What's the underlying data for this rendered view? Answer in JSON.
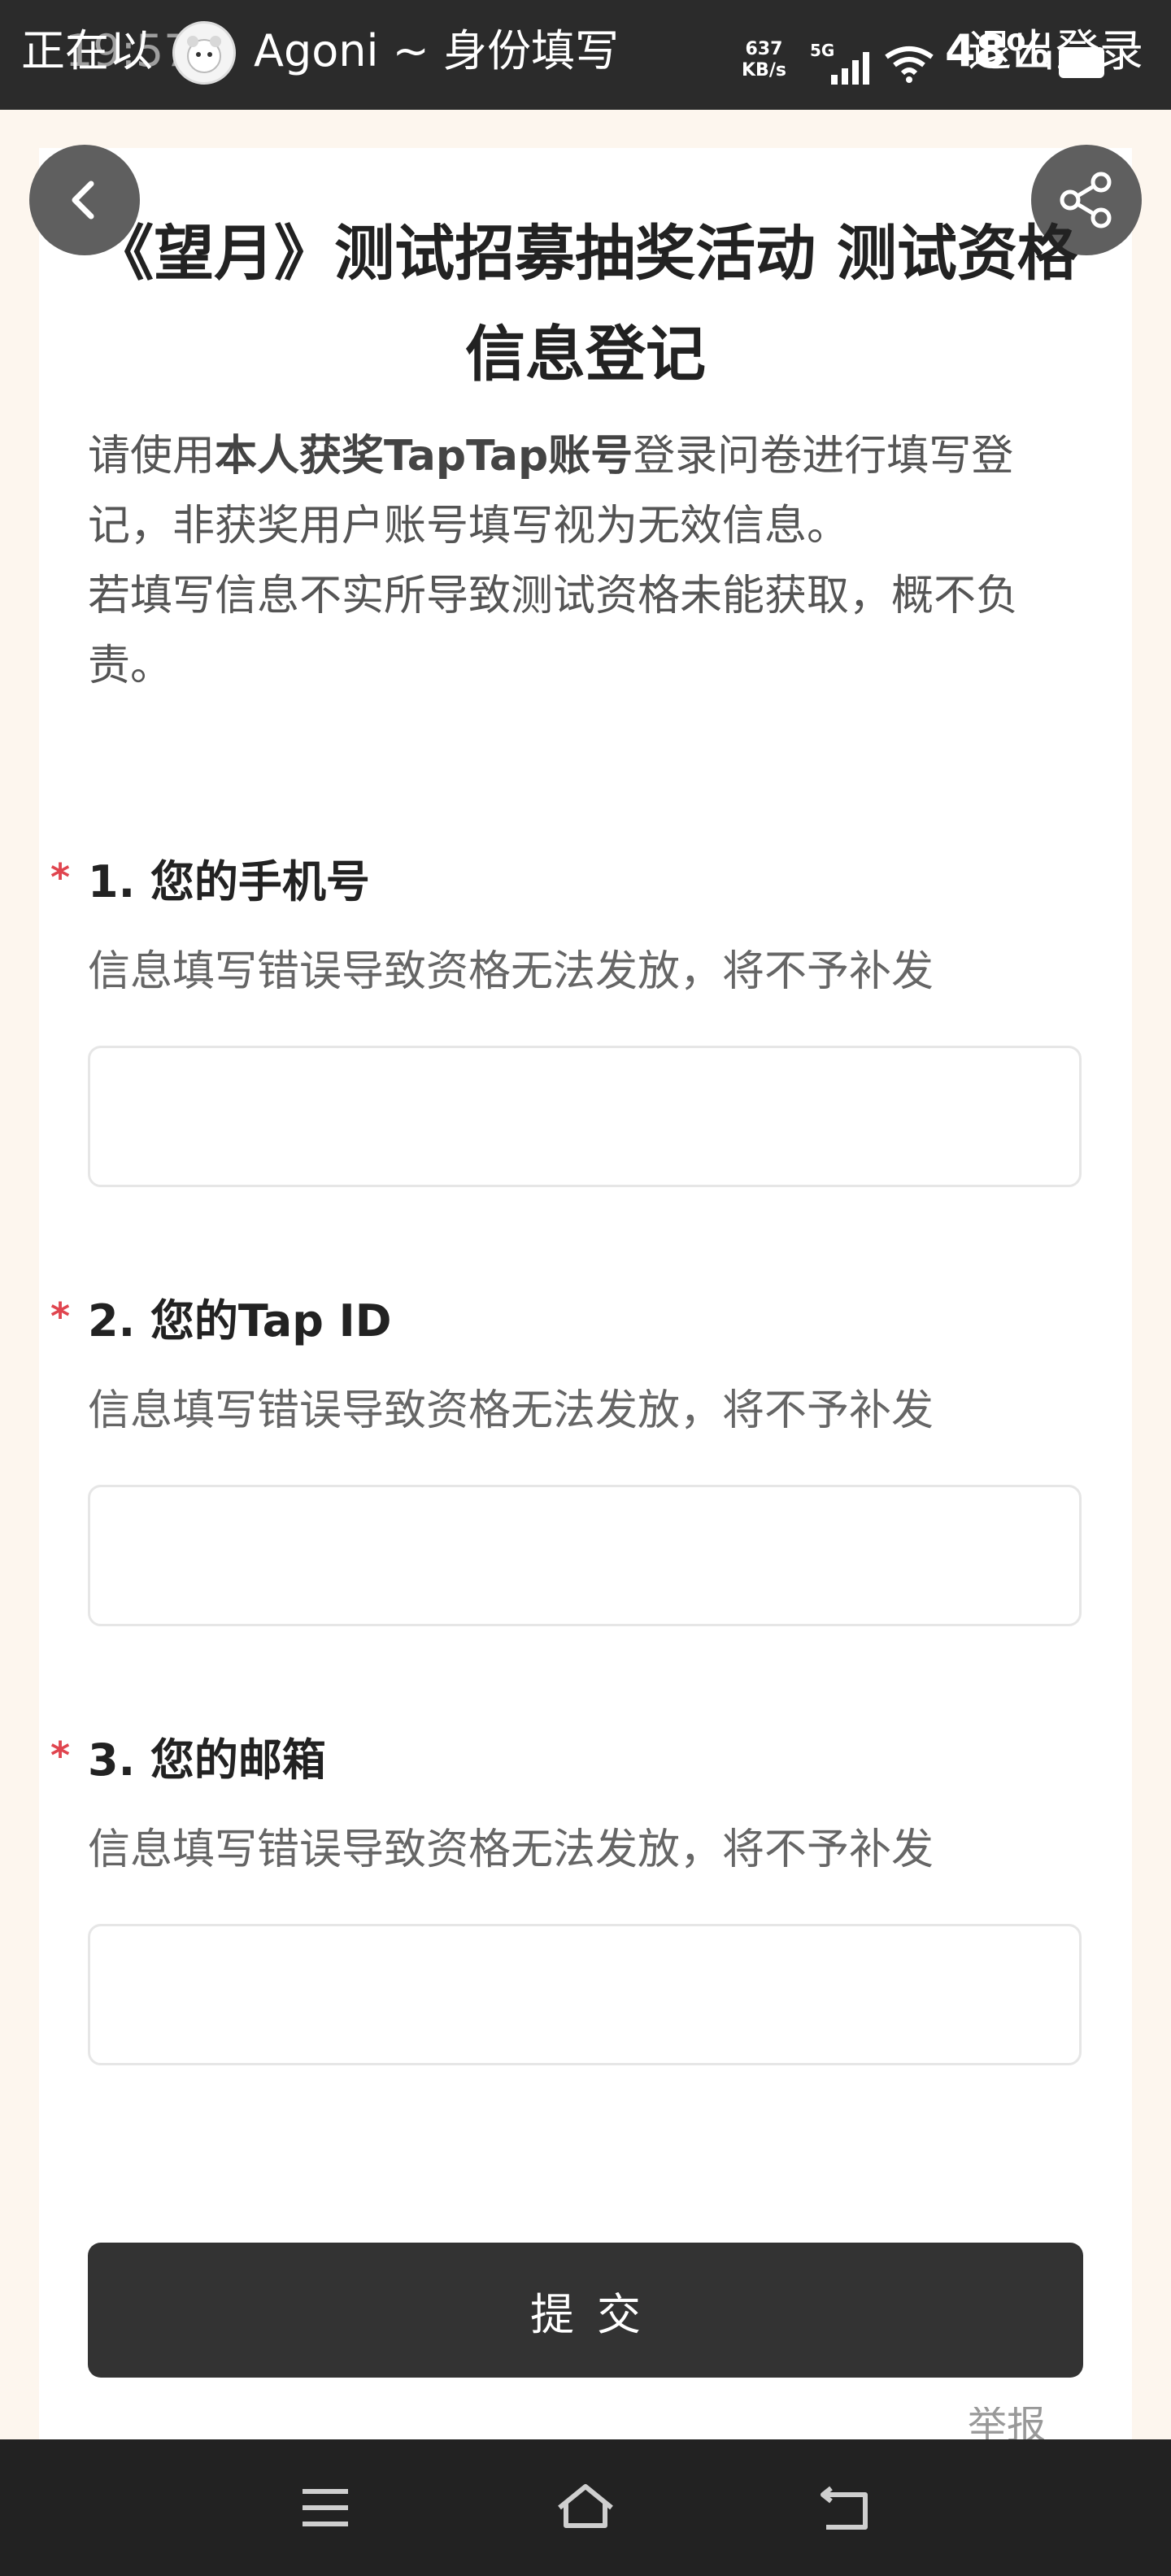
{
  "status_bar": {
    "live_text": "正在以",
    "time": "19:57",
    "account_name": "Agoni ~ 身份填写",
    "net_speed_value": "637",
    "net_speed_unit": "KB/s",
    "network_type": "5G",
    "battery": "48%",
    "logout_label": "退出登录"
  },
  "form": {
    "title": "《望月》测试招募抽奖活动 测试资格信息登记",
    "intro_prefix": "请使用",
    "intro_bold": "本人获奖TapTap账号",
    "intro_suffix": "登录问卷进行填写登记，非获奖用户账号填写视为无效信息。",
    "intro_line2": "若填写信息不实所导致测试资格未能获取，概不负责。",
    "required_mark": "*",
    "questions": [
      {
        "label": "1. 您的手机号",
        "description": "信息填写错误导致资格无法发放，将不予补发",
        "value": ""
      },
      {
        "label": "2. 您的Tap ID",
        "description": "信息填写错误导致资格无法发放，将不予补发",
        "value": ""
      },
      {
        "label": "3. 您的邮箱",
        "description": "信息填写错误导致资格无法发放，将不予补发",
        "value": ""
      }
    ],
    "submit_label": "提交",
    "report_label": "举报"
  },
  "colors": {
    "accent_dark": "#333333",
    "required": "#e0454f",
    "page_bg": "#fdf6ee"
  },
  "icons": [
    "back-icon",
    "share-icon",
    "menu-icon",
    "home-icon",
    "return-icon",
    "wifi-icon",
    "signal-icon",
    "battery-icon"
  ]
}
